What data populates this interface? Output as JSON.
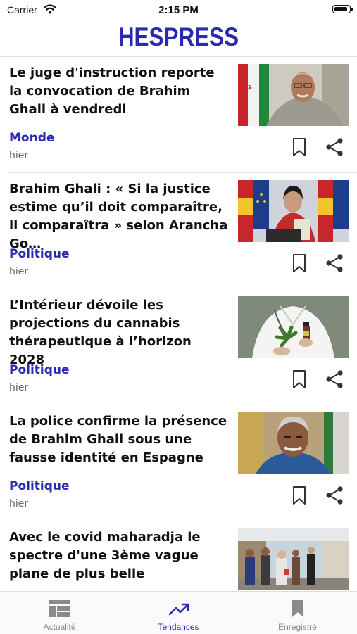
{
  "status_bar": {
    "carrier": "Carrier",
    "time": "2:15 PM"
  },
  "header": {
    "logo": "HESPRESS"
  },
  "articles": [
    {
      "title": "Le juge d'instruction reporte la convocation de Brahim Ghali à vendredi",
      "category": "Monde",
      "time": "hier",
      "image": "man-with-flag-photo"
    },
    {
      "title": "Brahim Ghali : « Si la justice estime qu’il doit comparaître, il comparaîtra » selon Arancha Go…",
      "category": "Politique",
      "time": "hier",
      "image": "woman-at-podium-photo"
    },
    {
      "title": "L’Intérieur dévoile les projections du cannabis thérapeutique à l’horizon 2028",
      "category": "Politique",
      "time": "hier",
      "image": "cannabis-doctor-photo"
    },
    {
      "title": "La police confirme la présence de Brahim Ghali sous une fausse identité en Espagne",
      "category": "Politique",
      "time": "hier",
      "image": "man-portrait-photo"
    },
    {
      "title": "Avec le covid maharadja le spectre d'une 3ème vague plane de plus belle",
      "category": "",
      "time": "",
      "image": "street-crowd-photo"
    }
  ],
  "tabs": [
    {
      "label": "Actualité",
      "icon": "news-grid-icon",
      "active": false
    },
    {
      "label": "Tendances",
      "icon": "trending-icon",
      "active": true
    },
    {
      "label": "Enregistré",
      "icon": "bookmark-icon",
      "active": false
    }
  ],
  "colors": {
    "brand": "#2a2ab0",
    "inactive": "#8a8a8a"
  }
}
